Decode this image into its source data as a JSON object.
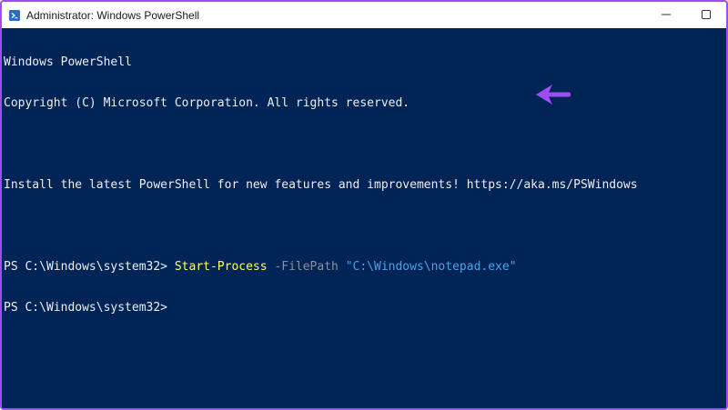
{
  "window": {
    "title": "Administrator: Windows PowerShell",
    "icon": "powershell-icon",
    "controls": [
      "minimize-icon",
      "maximize-icon"
    ]
  },
  "colors": {
    "console_background": "#012456",
    "default_text": "#eeedf0",
    "cmdlet": "#ffff60",
    "parameter": "#8a8f9a",
    "string": "#4aa1e8",
    "arrow": "#9d4df2"
  },
  "console": {
    "banner_line1": "Windows PowerShell",
    "banner_line2": "Copyright (C) Microsoft Corporation. All rights reserved.",
    "banner_line4": "Install the latest PowerShell for new features and improvements! https://aka.ms/PSWindows",
    "prompt1": "PS C:\\Windows\\system32> ",
    "command": "Start-Process",
    "parameter": " -FilePath ",
    "argument": "\"C:\\Windows\\notepad.exe\"",
    "prompt2": "PS C:\\Windows\\system32> "
  },
  "annotation": {
    "icon": "arrow-left-icon"
  }
}
